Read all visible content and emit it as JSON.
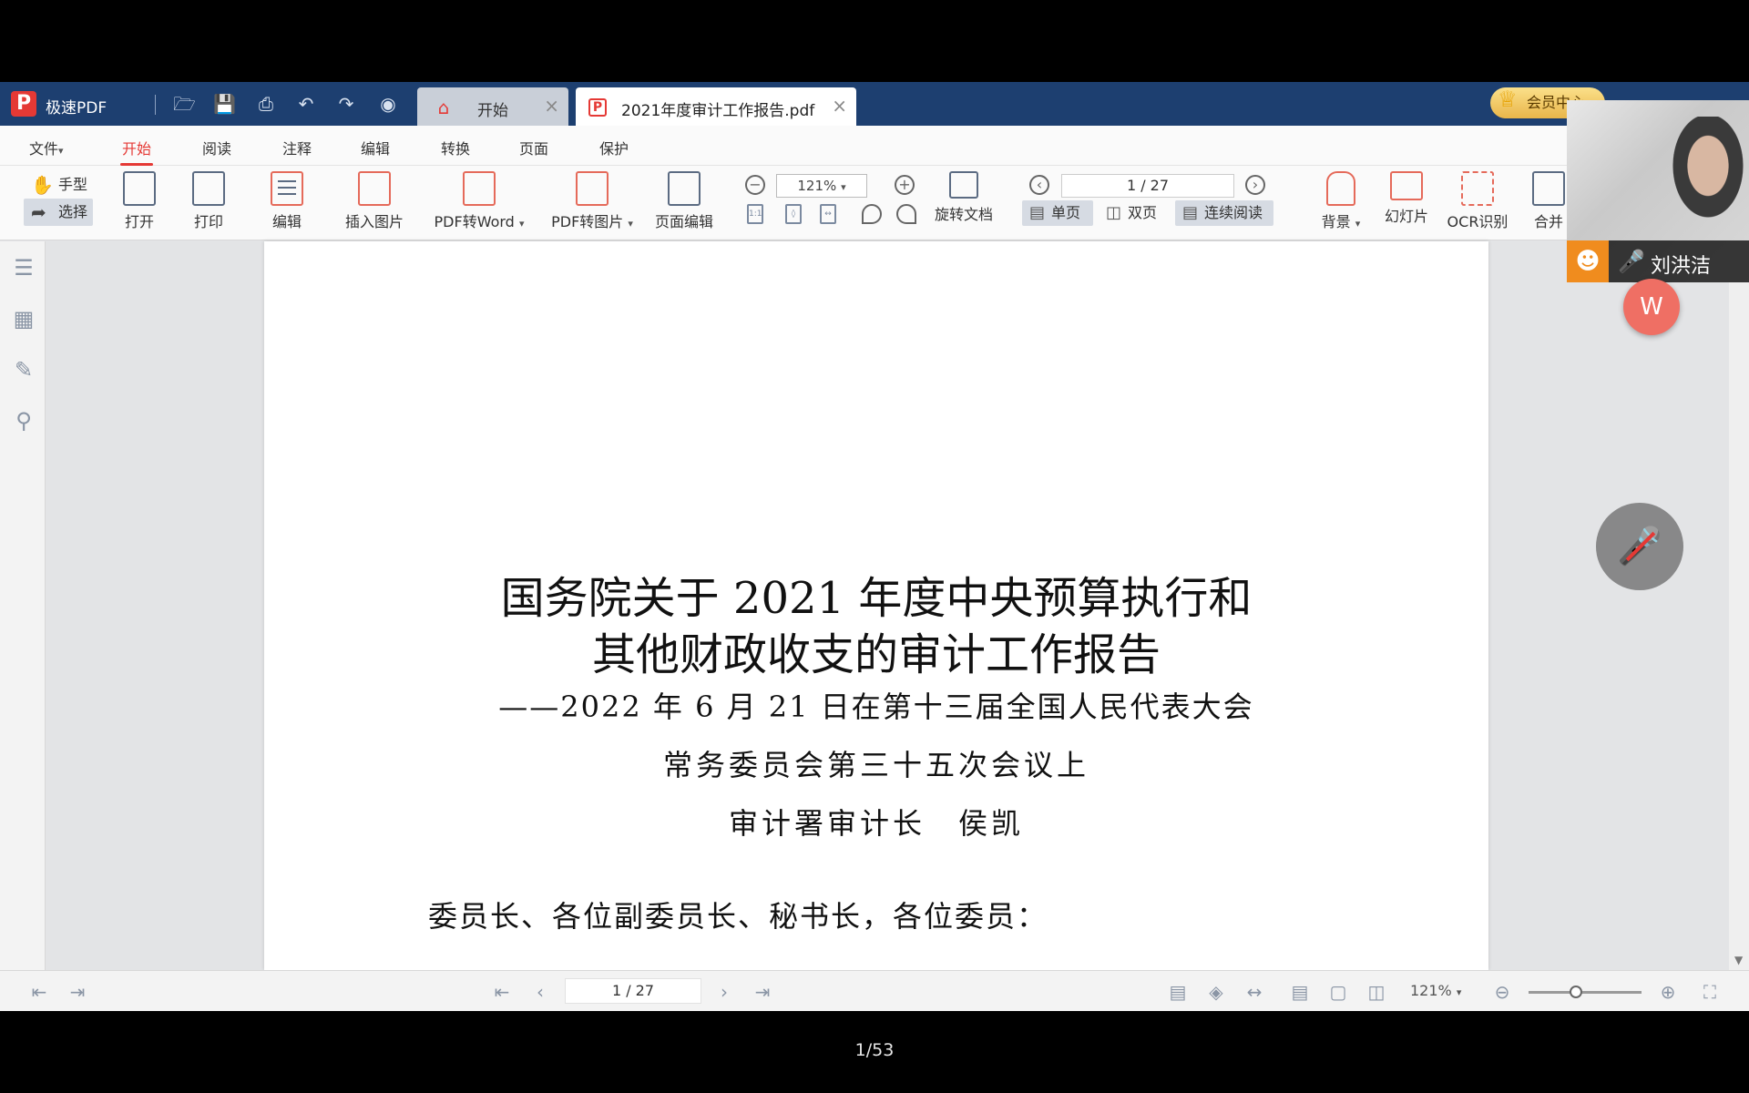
{
  "app": {
    "name": "极速PDF",
    "logo": "P"
  },
  "tabs": [
    {
      "label": "开始",
      "icon": "home-icon"
    },
    {
      "label": "2021年度审计工作报告.pdf",
      "icon": "pdf-file-icon"
    }
  ],
  "vip": {
    "label": "会员中心"
  },
  "menu": [
    "文件",
    "开始",
    "阅读",
    "注释",
    "编辑",
    "转换",
    "页面",
    "保护"
  ],
  "menu_active": "开始",
  "toolbar": {
    "hand": "手型",
    "select": "选择",
    "open": "打开",
    "print": "打印",
    "edit": "编辑",
    "insert_image": "插入图片",
    "pdf_to_word": "PDF转Word",
    "pdf_to_image": "PDF转图片",
    "page_edit": "页面编辑",
    "zoom": "121%",
    "rotate_doc": "旋转文档",
    "page": "1 / 27",
    "single": "单页",
    "double": "双页",
    "continuous": "连续阅读",
    "background": "背景",
    "slideshow": "幻灯片",
    "ocr": "OCR识别",
    "merge": "合并"
  },
  "document": {
    "title_line1": "国务院关于 2021 年度中央预算执行和",
    "title_line2": "其他财政收支的审计工作报告",
    "subtitle_line1": "——2022 年 6 月 21 日在第十三届全国人民代表大会",
    "subtitle_line2": "常务委员会第三十五次会议上",
    "author": "审计署审计长　侯凯",
    "greeting": "委员长、各位副委员长、秘书长，各位委员："
  },
  "status": {
    "page": "1 / 27",
    "zoom": "121%",
    "zoom_level": 0.42
  },
  "meeting": {
    "participant_name": "刘洪洁",
    "slide_counter": "1/53"
  },
  "colors": {
    "accent": "#e53935",
    "titlebar": "#1d3f70",
    "vip_gold": "#e9b64a"
  }
}
